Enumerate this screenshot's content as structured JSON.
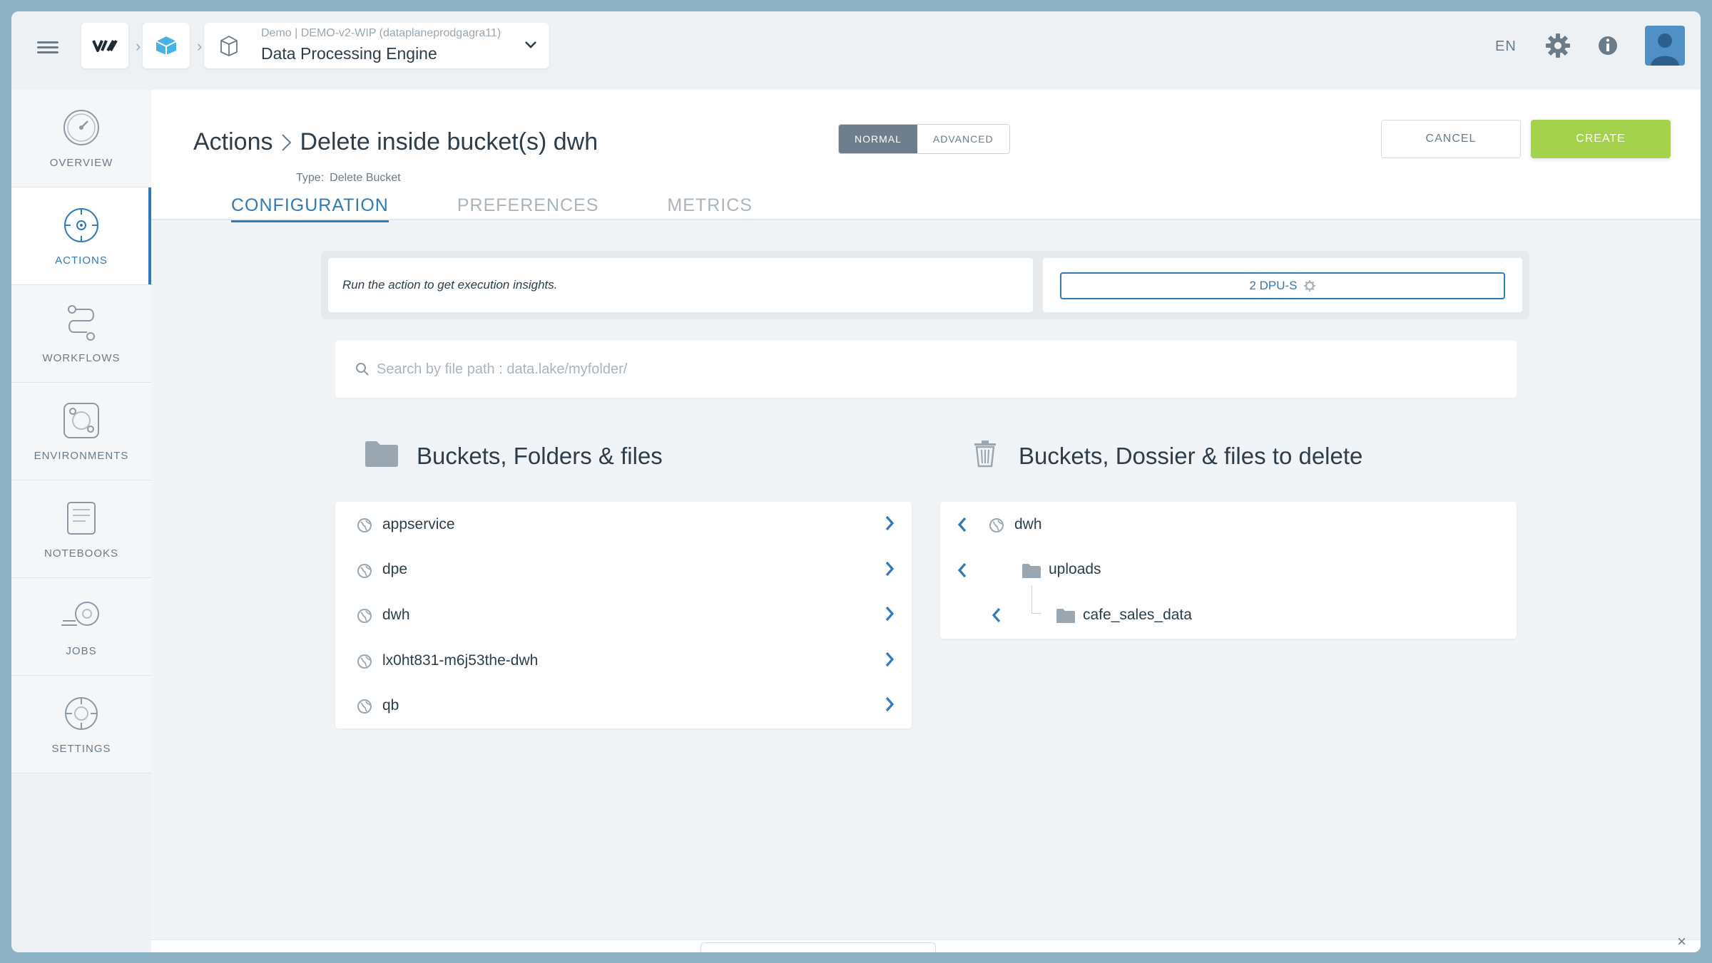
{
  "topbar": {
    "project_meta": "Demo | DEMO-v2-WIP (dataplaneprodgagra11)",
    "project_name": "Data Processing Engine",
    "language": "EN"
  },
  "sidebar": {
    "items": [
      {
        "label": "OVERVIEW",
        "icon": "gauge-icon"
      },
      {
        "label": "ACTIONS",
        "icon": "target-icon",
        "active": true
      },
      {
        "label": "WORKFLOWS",
        "icon": "workflow-icon"
      },
      {
        "label": "ENVIRONMENTS",
        "icon": "environment-icon"
      },
      {
        "label": "NOTEBOOKS",
        "icon": "notebook-icon"
      },
      {
        "label": "JOBS",
        "icon": "jobs-icon"
      },
      {
        "label": "SETTINGS",
        "icon": "settings-icon"
      }
    ]
  },
  "header": {
    "breadcrumb_root": "Actions",
    "title": "Delete inside bucket(s) dwh",
    "type_label": "Type:",
    "type_value": "Delete Bucket",
    "mode_normal": "NORMAL",
    "mode_advanced": "ADVANCED",
    "active_mode": "NORMAL",
    "cancel_label": "CANCEL",
    "create_label": "CREATE",
    "tabs": [
      "CONFIGURATION",
      "PREFERENCES",
      "METRICS"
    ],
    "active_tab": "CONFIGURATION"
  },
  "insights": {
    "message": "Run the action to get execution insights.",
    "dpu_label": "2 DPU-S"
  },
  "search": {
    "placeholder": "Search by file path : data.lake/myfolder/",
    "value": ""
  },
  "left_panel": {
    "title": "Buckets, Folders & files",
    "items": [
      "appservice",
      "dpe",
      "dwh",
      "lx0ht831-m6j53the-dwh",
      "qb"
    ]
  },
  "right_panel": {
    "title": "Buckets, Dossier & files to delete",
    "items": [
      {
        "name": "dwh",
        "type": "bucket",
        "depth": 0
      },
      {
        "name": "uploads",
        "type": "folder",
        "depth": 1
      },
      {
        "name": "cafe_sales_data",
        "type": "folder",
        "depth": 2
      }
    ]
  },
  "colors": {
    "accent": "#2f7ab8",
    "create": "#a4d24c",
    "text": "#2e3d4a",
    "muted": "#6b7b88"
  }
}
